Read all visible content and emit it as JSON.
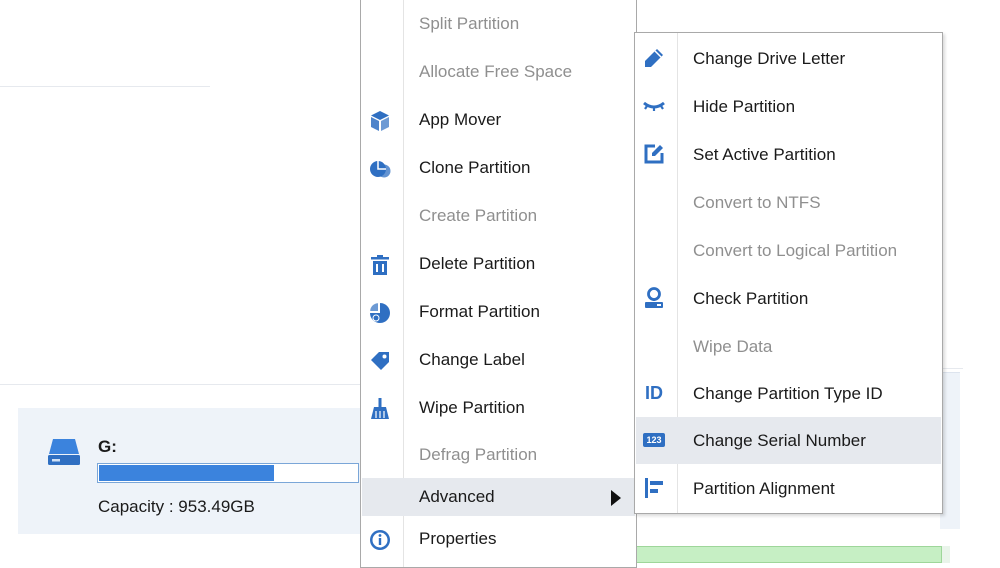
{
  "colors": {
    "accent": "#2f6fc2",
    "disabled_text": "#8f8f8f",
    "highlight": "#e6e9ee"
  },
  "disk": {
    "name": "G:",
    "capacity_label": "Capacity : 953.49GB",
    "used_fraction": 0.68,
    "icon": "drive-icon"
  },
  "main_menu": {
    "items": [
      {
        "label": "Split Partition",
        "enabled": false,
        "icon": ""
      },
      {
        "label": "Allocate Free Space",
        "enabled": false,
        "icon": ""
      },
      {
        "label": "App Mover",
        "enabled": true,
        "icon": "cube-icon"
      },
      {
        "label": "Clone Partition",
        "enabled": true,
        "icon": "clone-icon"
      },
      {
        "label": "Create Partition",
        "enabled": false,
        "icon": ""
      },
      {
        "label": "Delete Partition",
        "enabled": true,
        "icon": "trash-icon"
      },
      {
        "label": "Format Partition",
        "enabled": true,
        "icon": "format-icon"
      },
      {
        "label": "Change Label",
        "enabled": true,
        "icon": "tag-icon"
      },
      {
        "label": "Wipe Partition",
        "enabled": true,
        "icon": "broom-icon"
      },
      {
        "label": "Defrag Partition",
        "enabled": false,
        "icon": ""
      },
      {
        "label": "Advanced",
        "enabled": true,
        "icon": "",
        "has_submenu": true,
        "highlighted": true
      },
      {
        "label": "Properties",
        "enabled": true,
        "icon": "info-icon"
      }
    ]
  },
  "sub_menu": {
    "items": [
      {
        "label": "Change Drive Letter",
        "enabled": true,
        "icon": "pencil-icon"
      },
      {
        "label": "Hide Partition",
        "enabled": true,
        "icon": "eye-closed-icon"
      },
      {
        "label": "Set Active Partition",
        "enabled": true,
        "icon": "edit-box-icon"
      },
      {
        "label": "Convert to NTFS",
        "enabled": false,
        "icon": ""
      },
      {
        "label": "Convert to Logical Partition",
        "enabled": false,
        "icon": ""
      },
      {
        "label": "Check Partition",
        "enabled": true,
        "icon": "magnifier-drive-icon"
      },
      {
        "label": "Wipe Data",
        "enabled": false,
        "icon": ""
      },
      {
        "label": "Change Partition Type ID",
        "enabled": true,
        "icon": "id-icon",
        "icon_text": "ID"
      },
      {
        "label": "Change Serial Number",
        "enabled": true,
        "icon": "serial-icon",
        "icon_text": "123",
        "highlighted": true
      },
      {
        "label": "Partition Alignment",
        "enabled": true,
        "icon": "align-icon"
      }
    ]
  }
}
